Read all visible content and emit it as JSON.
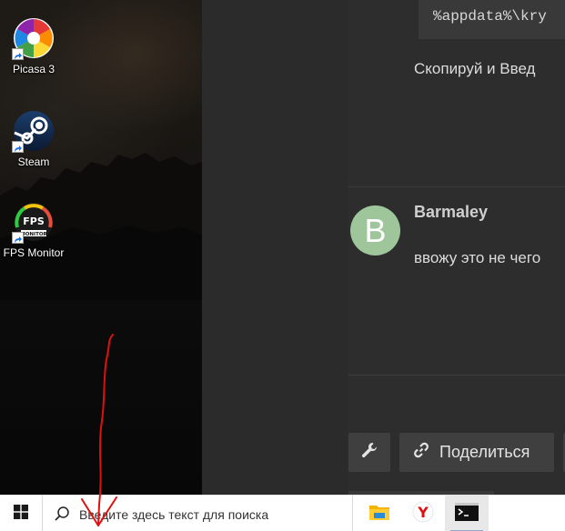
{
  "desktop": {
    "icons": [
      {
        "label": "Picasa 3",
        "icon": "picasa-icon"
      },
      {
        "label": "Steam",
        "icon": "steam-icon"
      },
      {
        "label": "FPS Monitor",
        "icon": "fps-monitor-icon"
      }
    ]
  },
  "forum": {
    "code_snippet": "%appdata%\\kry",
    "instruction_text": "Скопируй и Введ",
    "post": {
      "avatar_letter": "B",
      "author": "Barmaley",
      "text": "ввожу это не чего"
    },
    "actions": {
      "share_label": "Поделиться"
    }
  },
  "taskbar": {
    "search_placeholder": "Введите здесь текст для поиска",
    "apps": [
      {
        "name": "file-explorer-icon"
      },
      {
        "name": "yandex-browser-icon"
      },
      {
        "name": "command-prompt-icon"
      }
    ]
  },
  "colors": {
    "avatar": "#9fc59a",
    "annotation": "#e01010",
    "page_bg": "#2e2d2d"
  }
}
